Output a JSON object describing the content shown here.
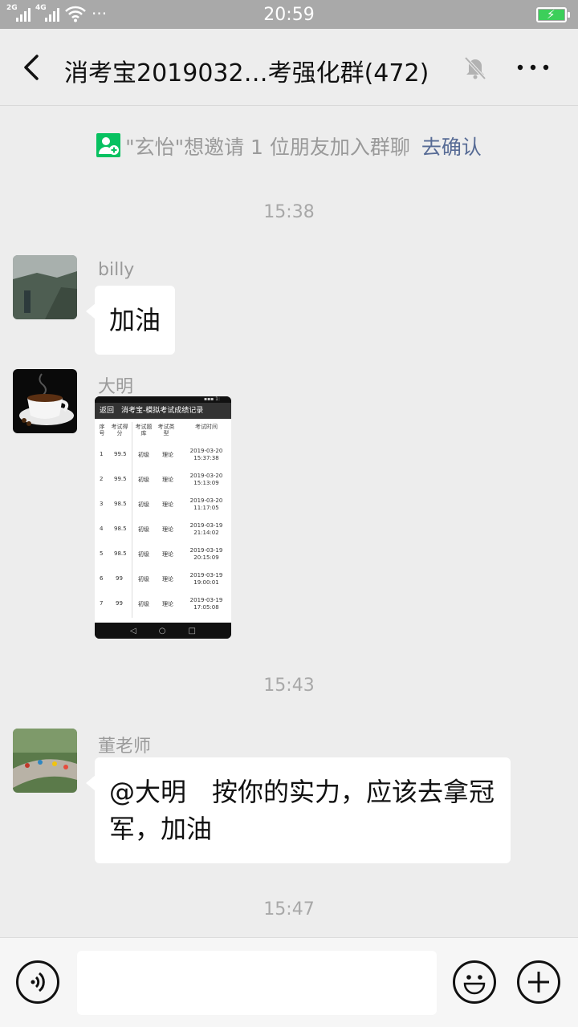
{
  "status_bar": {
    "signal1_label": "2G",
    "signal2_label": "4G",
    "more_dots": "···",
    "time": "20:59"
  },
  "header": {
    "title": "消考宝2019032…考强化群(472)"
  },
  "notice": {
    "text": "\"玄怡\"想邀请 1 位朋友加入群聊",
    "action": "去确认"
  },
  "messages": {
    "time1": "15:38",
    "billy_name": "billy",
    "billy_text": "加油",
    "daming_name": "大明",
    "time2": "15:43",
    "teacher_name": "董老师",
    "teacher_text": "@大明　按你的实力，应该去拿冠军，加油",
    "time3": "15:47"
  },
  "screenshot_image": {
    "title": "返回　消考宝-模拟考试成绩记录",
    "headers": [
      "序号",
      "考试得分",
      "考试题库",
      "考试类型",
      "考试时间"
    ],
    "rows": [
      {
        "no": "1",
        "score": "99.5",
        "bank": "初级",
        "type": "理论",
        "date": "2019-03-20",
        "time": "15:37:38"
      },
      {
        "no": "2",
        "score": "99.5",
        "bank": "初级",
        "type": "理论",
        "date": "2019-03-20",
        "time": "15:13:09"
      },
      {
        "no": "3",
        "score": "98.5",
        "bank": "初级",
        "type": "理论",
        "date": "2019-03-20",
        "time": "11:17:05"
      },
      {
        "no": "4",
        "score": "98.5",
        "bank": "初级",
        "type": "理论",
        "date": "2019-03-19",
        "time": "21:14:02"
      },
      {
        "no": "5",
        "score": "98.5",
        "bank": "初级",
        "type": "理论",
        "date": "2019-03-19",
        "time": "20:15:09"
      },
      {
        "no": "6",
        "score": "99",
        "bank": "初级",
        "type": "理论",
        "date": "2019-03-19",
        "time": "19:00:01"
      },
      {
        "no": "7",
        "score": "99",
        "bank": "初级",
        "type": "理论",
        "date": "2019-03-19",
        "time": "17:05:08"
      }
    ]
  },
  "colors": {
    "accent_link": "#576b95",
    "wechat_green": "#07c160",
    "battery_green": "#3ccf5a"
  }
}
